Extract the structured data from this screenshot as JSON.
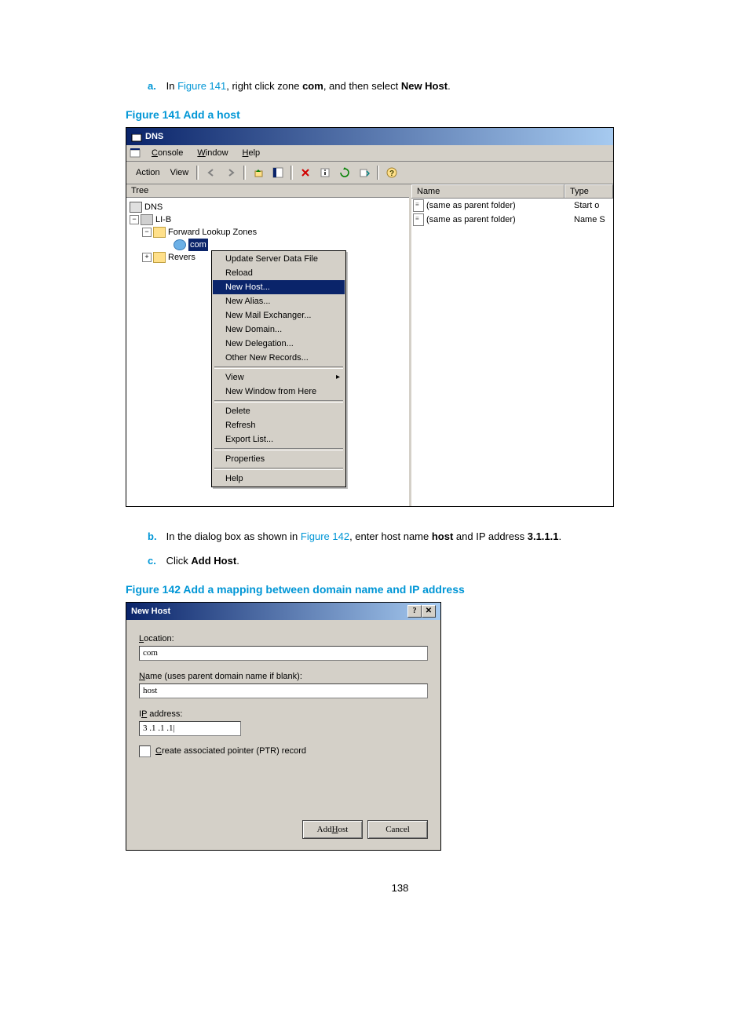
{
  "steps": {
    "a": {
      "pre": "In ",
      "link": "Figure 141",
      "mid": ", right click zone ",
      "b1": "com",
      "mid2": ", and then select ",
      "b2": "New Host",
      "end": "."
    },
    "b": {
      "pre": "In the dialog box as shown in ",
      "link": "Figure 142",
      "mid": ", enter host name ",
      "b1": "host",
      "mid2": " and IP address ",
      "b2": "3.1.1.1",
      "end": "."
    },
    "c": {
      "pre": "Click ",
      "b1": "Add Host",
      "end": "."
    }
  },
  "captions": {
    "fig141": "Figure 141 Add a host",
    "fig142": "Figure 142 Add a mapping between domain name and IP address"
  },
  "mmc": {
    "title": "DNS",
    "menu": {
      "console": "Console",
      "window": "Window",
      "help": "Help"
    },
    "toolbar": {
      "action": "Action",
      "view": "View"
    },
    "treeHeader": "Tree",
    "tree": {
      "root": "DNS",
      "server": "LI-B",
      "fwd": "Forward Lookup Zones",
      "zone": "com",
      "rev": "Revers"
    },
    "listCols": {
      "name": "Name",
      "type": "Type"
    },
    "listRows": [
      {
        "name": "(same as parent folder)",
        "type": "Start o"
      },
      {
        "name": "(same as parent folder)",
        "type": "Name S"
      }
    ],
    "ctx": {
      "update": "Update Server Data File",
      "reload": "Reload",
      "newhost": "New Host...",
      "newalias": "New Alias...",
      "newmx": "New Mail Exchanger...",
      "newdomain": "New Domain...",
      "newdeleg": "New Delegation...",
      "other": "Other New Records...",
      "view": "View",
      "newwin": "New Window from Here",
      "delete": "Delete",
      "refresh": "Refresh",
      "export": "Export List...",
      "props": "Properties",
      "help": "Help"
    }
  },
  "dlg": {
    "title": "New Host",
    "location_lbl": "Location:",
    "location_val": "com",
    "name_lbl": "Name (uses parent domain name if blank):",
    "name_val": "host",
    "ip_lbl": "IP address:",
    "ip_val": "3     .1     .1     .1|",
    "chk_lbl": "Create associated pointer (PTR) record",
    "addhost": "Add Host",
    "cancel": "Cancel"
  },
  "pageNum": "138"
}
